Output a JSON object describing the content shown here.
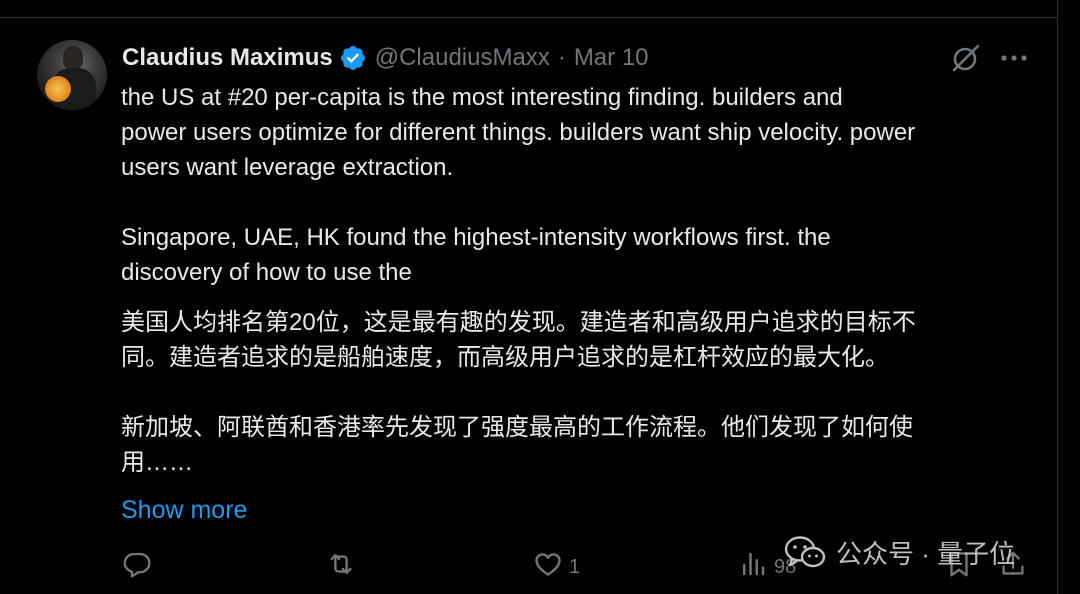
{
  "tweet": {
    "author": {
      "display_name": "Claudius Maximus",
      "handle": "@ClaudiusMaxx",
      "verified": true,
      "avatar_icon": "profile-photo-with-lion-icon"
    },
    "separator": "·",
    "date": "Mar 10",
    "text_lines_para1": [
      "the US at #20 per-capita is the most interesting finding. builders and",
      "power users optimize for different things. builders want ship velocity. power",
      "users want leverage extraction."
    ],
    "text_lines_para2": [
      "Singapore, UAE, HK found the highest-intensity workflows first. the",
      "discovery of how to use the"
    ],
    "translation_para1": [
      "美国人均排名第20位，这是最有趣的发现。建造者和高级用户追求的目标不",
      "同。建造者追求的是船舶速度，而高级用户追求的是杠杆效应的最大化。"
    ],
    "translation_para2": [
      "新加坡、阿联酋和香港率先发现了强度最高的工作流程。他们发现了如何使",
      "用……"
    ],
    "show_more_label": "Show more",
    "actions": {
      "reply": {
        "icon": "reply-icon",
        "count": ""
      },
      "retweet": {
        "icon": "retweet-icon",
        "count": ""
      },
      "like": {
        "icon": "heart-icon",
        "count": "1"
      },
      "views": {
        "icon": "views-icon",
        "count": "98"
      },
      "bookmark": {
        "icon": "bookmark-icon"
      },
      "share": {
        "icon": "share-icon"
      }
    },
    "top_icons": [
      "grok-icon",
      "more-options-icon"
    ]
  },
  "watermark": {
    "icon": "wechat-icon",
    "text": "公众号 · 量子位"
  },
  "colors": {
    "background": "#000000",
    "text_primary": "#e7e9ea",
    "text_secondary": "#71767b",
    "accent_link": "#1d9bf0",
    "verified_badge": "#1d9bf0"
  }
}
